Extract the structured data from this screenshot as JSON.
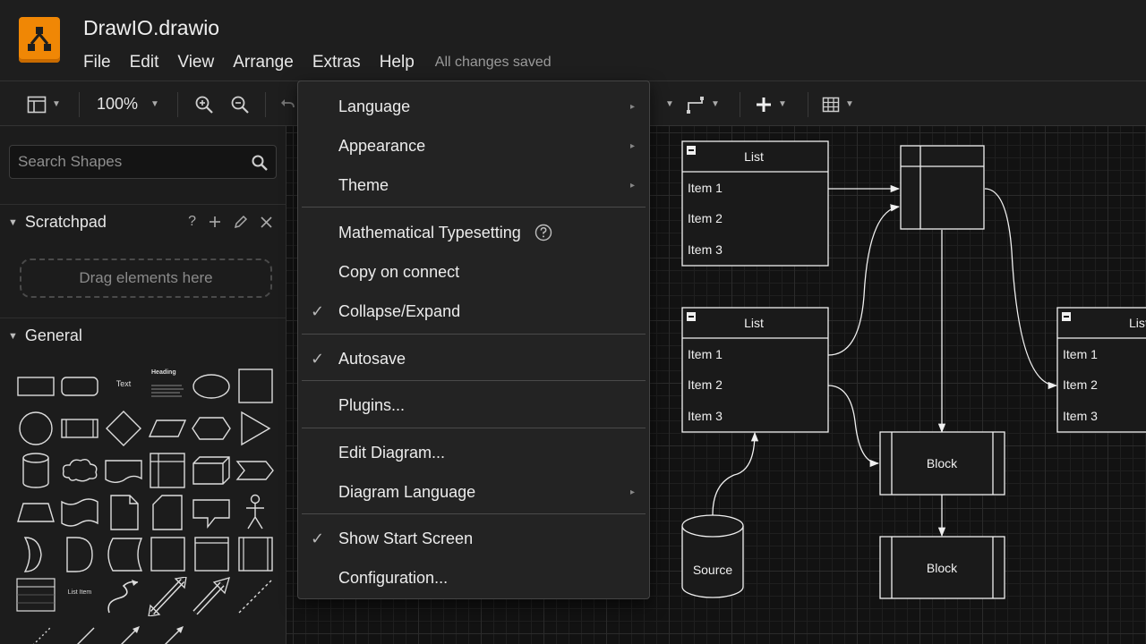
{
  "app": {
    "title": "DrawIO.drawio",
    "logo_color": "#f08705",
    "save_status": "All changes saved"
  },
  "menubar": {
    "items": [
      "File",
      "Edit",
      "View",
      "Arrange",
      "Extras",
      "Help"
    ]
  },
  "toolbar": {
    "zoom": "100%",
    "icons": [
      "format-panel-icon",
      "zoom-in-icon",
      "zoom-out-icon",
      "undo-icon",
      "connector-style-icon",
      "waypoint-icon",
      "insert-icon",
      "table-icon"
    ]
  },
  "left_panel": {
    "search_placeholder": "Search Shapes",
    "scratchpad": {
      "title": "Scratchpad",
      "help": "?",
      "drop_hint": "Drag elements here"
    },
    "general": {
      "title": "General",
      "text_shape_label": "Text",
      "heading_shape_label": "Heading",
      "list_item_label": "List Item"
    }
  },
  "extras_menu": {
    "items": [
      {
        "label": "Language",
        "checked": false,
        "submenu": true
      },
      {
        "label": "Appearance",
        "checked": false,
        "submenu": true
      },
      {
        "label": "Theme",
        "checked": false,
        "submenu": true
      },
      {
        "label": "Mathematical Typesetting",
        "checked": false,
        "submenu": false,
        "help": true
      },
      {
        "label": "Copy on connect",
        "checked": false,
        "submenu": false
      },
      {
        "label": "Collapse/Expand",
        "checked": true,
        "submenu": false
      },
      {
        "label": "Autosave",
        "checked": true,
        "submenu": false
      },
      {
        "label": "Plugins...",
        "checked": false,
        "submenu": false
      },
      {
        "label": "Edit Diagram...",
        "checked": false,
        "submenu": false
      },
      {
        "label": "Diagram Language",
        "checked": false,
        "submenu": true
      },
      {
        "label": "Show Start Screen",
        "checked": true,
        "submenu": false
      },
      {
        "label": "Configuration...",
        "checked": false,
        "submenu": false
      }
    ],
    "check_glyph": "✓",
    "submenu_glyph": "▸"
  },
  "diagram": {
    "lists": [
      {
        "title": "List",
        "items": [
          "Item 1",
          "Item 2",
          "Item 3"
        ]
      },
      {
        "title": "List",
        "items": [
          "Item 1",
          "Item 2",
          "Item 3"
        ]
      },
      {
        "title": "List",
        "items": [
          "Item 1",
          "Item 2",
          "Item 3"
        ]
      }
    ],
    "blocks": [
      "Block",
      "Block"
    ],
    "source": "Source",
    "stroke_color": "#f0f0f0",
    "fill_color": "#1a1a1a"
  }
}
